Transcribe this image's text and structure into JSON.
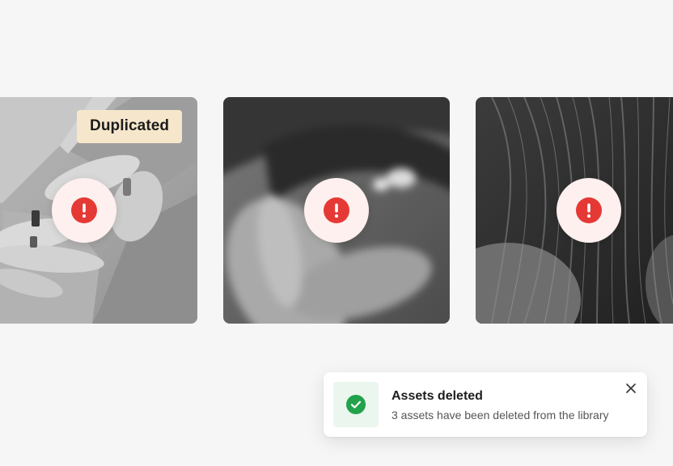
{
  "assets": [
    {
      "badge": "Duplicated",
      "status": "error",
      "status_icon": "exclamation-icon"
    },
    {
      "badge": "",
      "status": "error",
      "status_icon": "exclamation-icon"
    },
    {
      "badge": "",
      "status": "error",
      "status_icon": "exclamation-icon"
    }
  ],
  "toast": {
    "title": "Assets deleted",
    "message": "3 assets have been deleted from the library",
    "icon": "check-circle-icon",
    "close_icon": "close-icon"
  },
  "colors": {
    "background": "#f6f6f6",
    "error": "#e53935",
    "error_bg": "#fdf0ee",
    "success": "#22a24a",
    "success_bg": "#ebf6ee",
    "badge_bg": "#f6e7cc"
  }
}
